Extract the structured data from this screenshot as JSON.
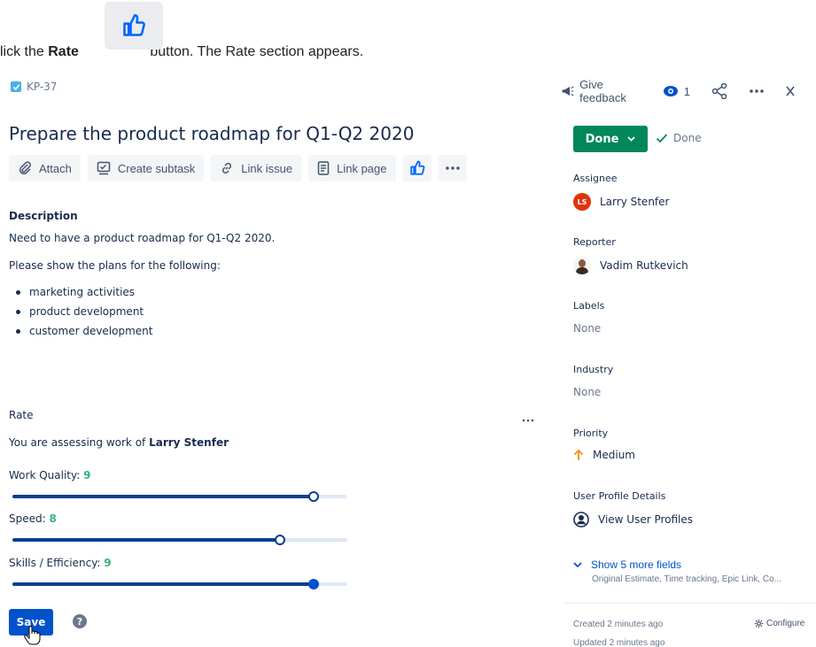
{
  "instruction": {
    "prefix": "lick the ",
    "bold": "Rate",
    "suffix": " button. The Rate section appears."
  },
  "issue": {
    "key": "KP-37",
    "title": "Prepare the product roadmap for Q1-Q2 2020"
  },
  "top_actions": {
    "feedback": "Give feedback",
    "watchers": "1"
  },
  "toolbar": {
    "attach": "Attach",
    "create_subtask": "Create subtask",
    "link_issue": "Link issue",
    "link_page": "Link page"
  },
  "description": {
    "label": "Description",
    "line1": "Need to have a product roadmap for Q1-Q2 2020.",
    "line2": "Please show the plans for the following:",
    "bullets": [
      "marketing activities",
      "product development",
      "customer development"
    ]
  },
  "rate": {
    "label": "Rate",
    "assessing_prefix": "You are assessing work of ",
    "assessing_name": "Larry Stenfer",
    "criteria": [
      {
        "label": "Work Quality: ",
        "score": "9",
        "fraction": 0.9
      },
      {
        "label": "Speed: ",
        "score": "8",
        "fraction": 0.8
      },
      {
        "label": "Skills / Efficiency: ",
        "score": "9",
        "fraction": 0.9
      }
    ],
    "save": "Save",
    "help": "?"
  },
  "sidebar": {
    "status": "Done",
    "resolution": "Done",
    "assignee_label": "Assignee",
    "assignee_initials": "LS",
    "assignee_name": "Larry Stenfer",
    "reporter_label": "Reporter",
    "reporter_name": "Vadim Rutkevich",
    "labels_label": "Labels",
    "labels_value": "None",
    "industry_label": "Industry",
    "industry_value": "None",
    "priority_label": "Priority",
    "priority_value": "Medium",
    "profile_label": "User Profile Details",
    "profile_link": "View User Profiles",
    "more_fields": "Show 5 more fields",
    "more_fields_sub": "Original Estimate, Time tracking, Epic Link, Co...",
    "created": "Created 2 minutes ago",
    "updated": "Updated 2 minutes ago",
    "configure": "Configure"
  },
  "colors": {
    "primary": "#0052cc",
    "success": "#00875a",
    "score": "#36b37e",
    "slider": "#0b3d91"
  }
}
